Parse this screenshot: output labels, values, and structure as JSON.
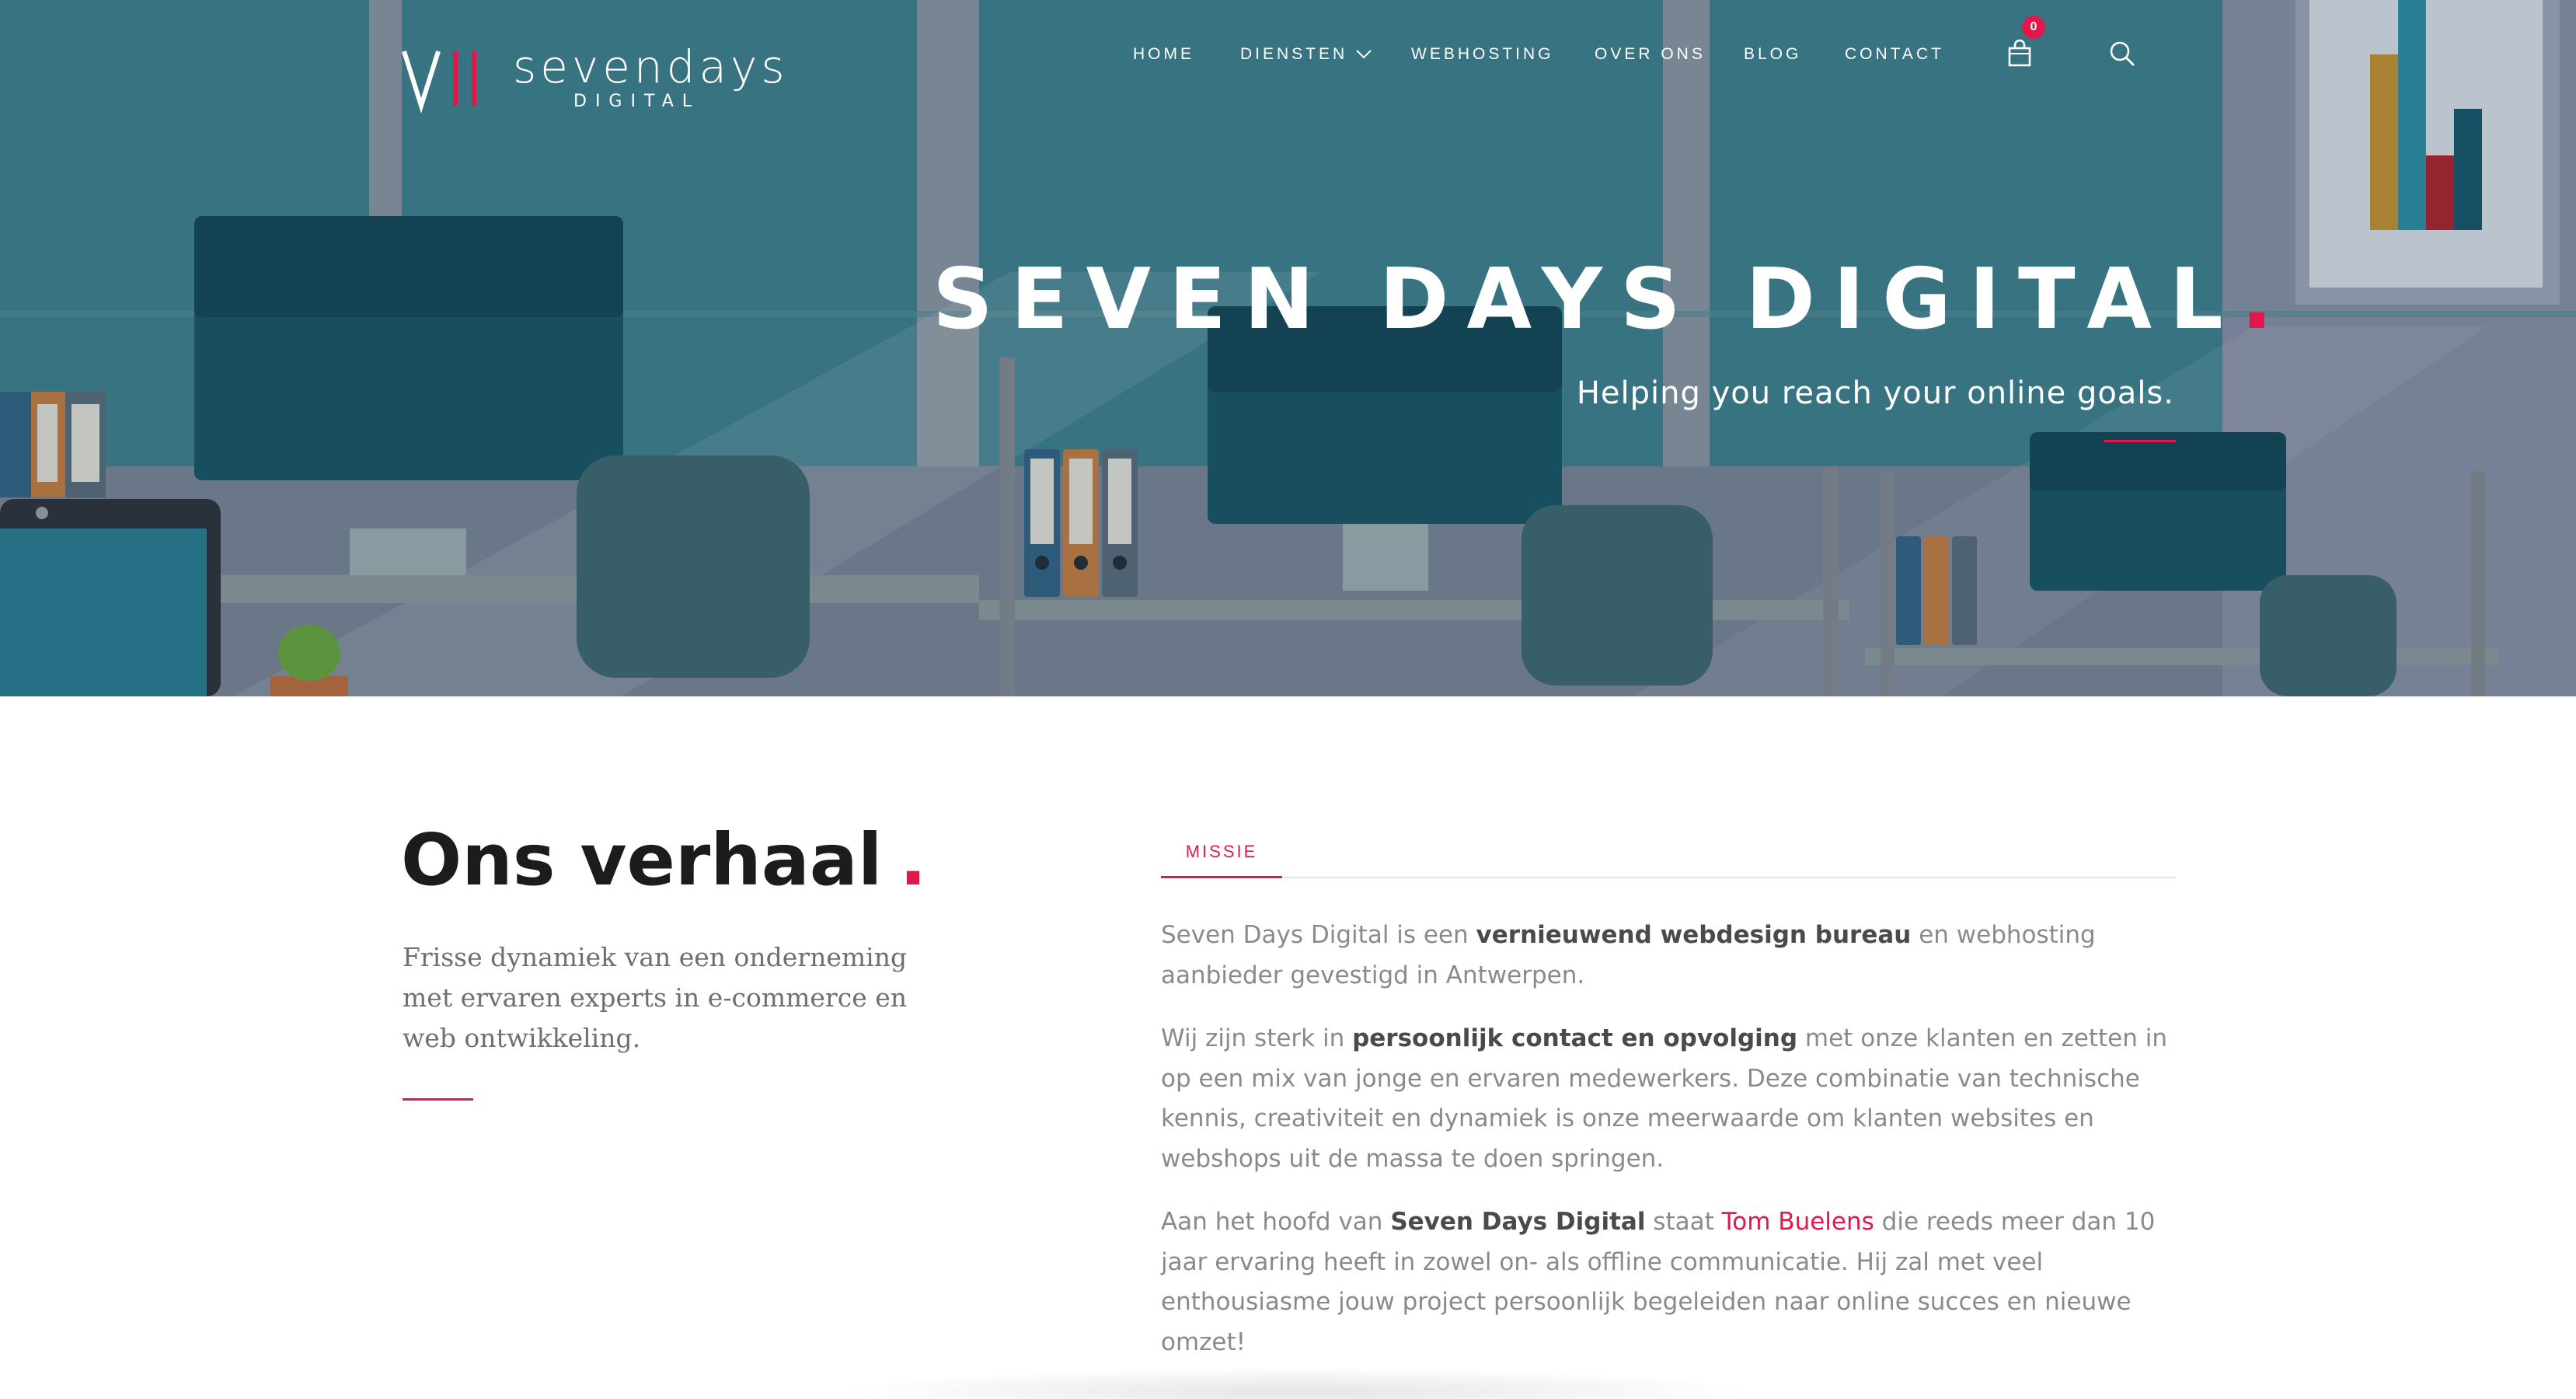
{
  "brand": {
    "mark": "VII",
    "name": "sevendays",
    "subtitle": "DIGITAL",
    "accent_color": "#e2174a"
  },
  "nav": {
    "items": [
      {
        "label": "HOME",
        "has_dropdown": false
      },
      {
        "label": "DIENSTEN",
        "has_dropdown": true
      },
      {
        "label": "WEBHOSTING",
        "has_dropdown": false
      },
      {
        "label": "OVER ONS",
        "has_dropdown": false
      },
      {
        "label": "BLOG",
        "has_dropdown": false
      },
      {
        "label": "CONTACT",
        "has_dropdown": false
      }
    ],
    "cart_icon": "shopping-bag-icon",
    "cart_count": "0",
    "search_icon": "search-icon"
  },
  "hero": {
    "title": "SEVEN DAYS DIGITAL",
    "title_dot": ".",
    "subtitle": "Helping you reach your online goals."
  },
  "story": {
    "title": "Ons verhaal",
    "title_dot": ".",
    "text": "Frisse dynamiek van een onderneming met ervaren experts in e-commerce en web ontwikkeling."
  },
  "tabs": [
    {
      "label": "MISSIE",
      "active": true
    }
  ],
  "mission": {
    "p1": {
      "a": "Seven Days Digital is een ",
      "b": "vernieuwend webdesign bureau",
      "c": " en webhosting aanbieder gevestigd in Antwerpen."
    },
    "p2": {
      "a": "Wij zijn sterk in ",
      "b": "persoonlijk contact en opvolging",
      "c": " met onze klanten en zetten in op een mix van jonge en ervaren medewerkers. Deze combinatie van technische kennis, creativiteit en dynamiek is onze meerwaarde om klanten websites en webshops uit de massa te doen springen."
    },
    "p3": {
      "a": "Aan het hoofd van ",
      "b": "Seven Days Digital",
      "c": " staat ",
      "link": "Tom Buelens",
      "d": " die reeds meer dan 10 jaar ervaring heeft in zowel on- als offline communicatie. Hij zal met veel enthousiasme jouw project persoonlijk begeleiden naar online succes en nieuwe omzet!"
    }
  }
}
